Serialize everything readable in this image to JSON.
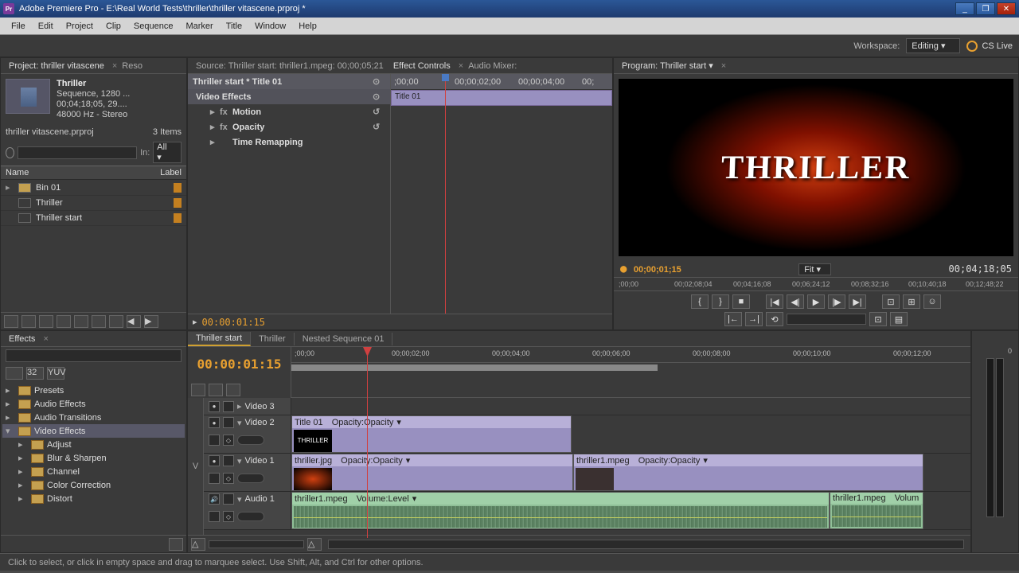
{
  "titlebar": {
    "app_icon_label": "Pr",
    "title": "Adobe Premiere Pro - E:\\Real World Tests\\thriller\\thriller vitascene.prproj *"
  },
  "menubar": [
    "File",
    "Edit",
    "Project",
    "Clip",
    "Sequence",
    "Marker",
    "Title",
    "Window",
    "Help"
  ],
  "workspace": {
    "label": "Workspace:",
    "value": "Editing",
    "cs_live": "CS Live"
  },
  "project_panel": {
    "tab": "Project: thriller vitascene",
    "reso_label": "Reso",
    "clip": {
      "name": "Thriller",
      "type": "Sequence, 1280 ...",
      "duration": "00;04;18;05, 29....",
      "audio": "48000 Hz - Stereo"
    },
    "filename": "thriller vitascene.prproj",
    "item_count": "3 Items",
    "in_label": "In:",
    "in_value": "All",
    "col_name": "Name",
    "col_label": "Label",
    "items": [
      {
        "name": "Bin 01"
      },
      {
        "name": "Thriller"
      },
      {
        "name": "Thriller start"
      }
    ]
  },
  "source_panel": {
    "tabs": {
      "source": "Source: Thriller start: thriller1.mpeg: 00;00;05;21",
      "effect_controls": "Effect Controls",
      "audio_mixer": "Audio Mixer:"
    },
    "ec_header": "Thriller start * Title 01",
    "ec_clip": "Title 01",
    "video_effects": "Video Effects",
    "effects": {
      "motion": "Motion",
      "opacity": "Opacity",
      "time_remap": "Time Remapping"
    },
    "ruler": [
      ";00;00",
      "00;00;02;00",
      "00;00;04;00",
      "00;"
    ],
    "timecode": "00:00:01:15"
  },
  "program_panel": {
    "tab": "Program: Thriller start",
    "title_text": "THRILLER",
    "timecode_left": "00;00;01;15",
    "fit": "Fit",
    "timecode_right": "00;04;18;05",
    "ruler": [
      ";00;00",
      "00;02;08;04",
      "00;04;16;08",
      "00;06;24;12",
      "00;08;32;16",
      "00;10;40;18",
      "00;12;48;22"
    ]
  },
  "effects_browser": {
    "tab": "Effects",
    "folders": {
      "presets": "Presets",
      "audio_effects": "Audio Effects",
      "audio_transitions": "Audio Transitions",
      "video_effects": "Video Effects",
      "children": [
        "Adjust",
        "Blur & Sharpen",
        "Channel",
        "Color Correction",
        "Distort"
      ]
    }
  },
  "timeline": {
    "tabs": [
      "Thriller start",
      "Thriller",
      "Nested Sequence 01"
    ],
    "timecode": "00:00:01:15",
    "ruler": [
      ";00;00",
      "00;00;02;00",
      "00;00;04;00",
      "00;00;06;00",
      "00;00;08;00",
      "00;00;10;00",
      "00;00;12;00"
    ],
    "tracks": {
      "video3": "Video 3",
      "video2": "Video 2",
      "video1": "Video 1",
      "audio1": "Audio 1"
    },
    "v_label": "V",
    "clips": {
      "title01": {
        "name": "Title 01",
        "opacity": "Opacity:Opacity"
      },
      "thriller_jpg": {
        "name": "thriller.jpg",
        "opacity": "Opacity:Opacity"
      },
      "thriller1_mpeg": {
        "name": "thriller1.mpeg",
        "opacity": "Opacity:Opacity"
      },
      "thriller1_audio": {
        "name": "thriller1.mpeg",
        "volume": "Volume:Level"
      },
      "thriller1_audio2": {
        "name": "thriller1.mpeg",
        "volume": "Volum"
      }
    }
  },
  "meters": {
    "scale_0": "0"
  },
  "statusbar": {
    "hint": "Click to select, or click in empty space and drag to marquee select. Use Shift, Alt, and Ctrl for other options."
  }
}
